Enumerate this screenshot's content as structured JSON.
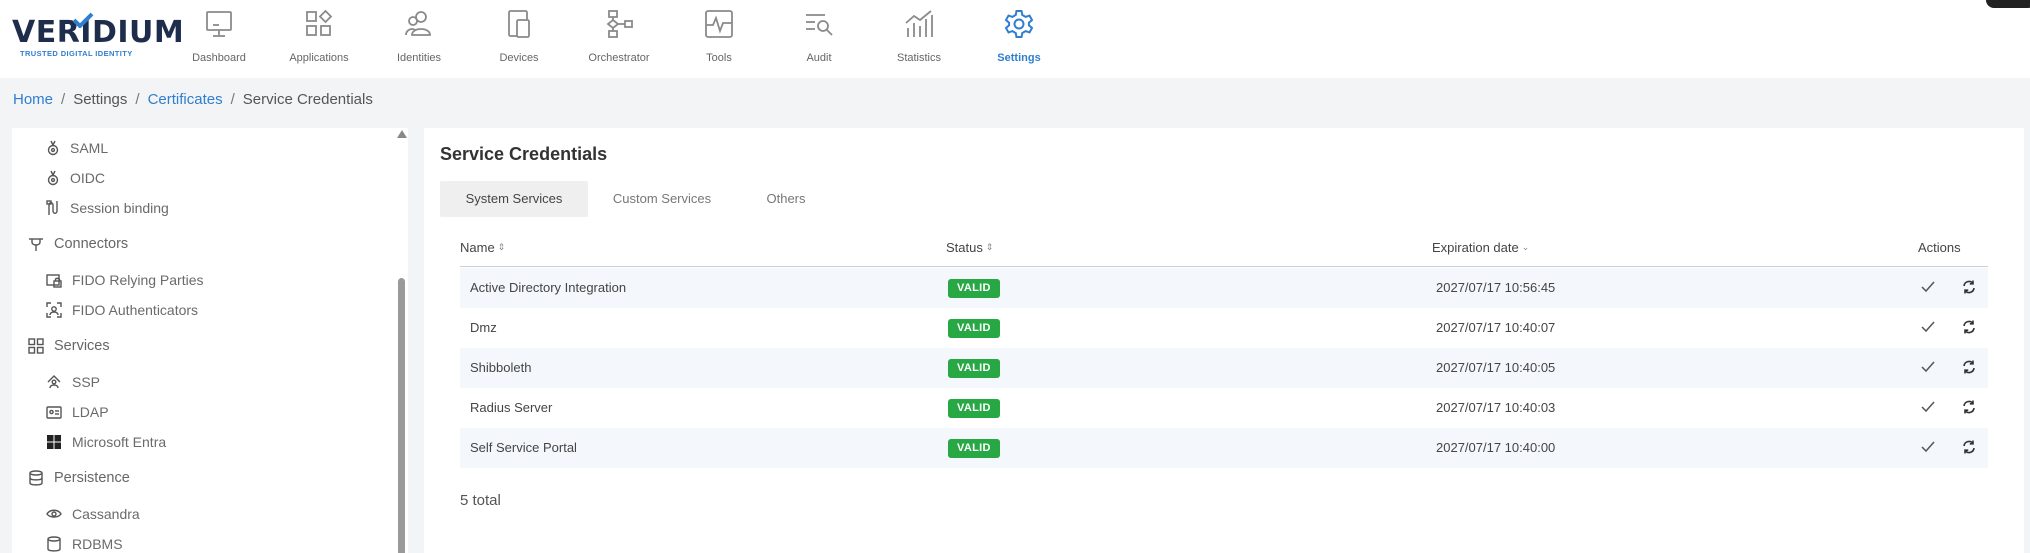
{
  "app": {
    "logo_text": "VERIDIUM",
    "logo_tagline": "TRUSTED DIGITAL IDENTITY"
  },
  "nav": {
    "items": [
      {
        "label": "Dashboard",
        "icon": "monitor-icon",
        "active": false
      },
      {
        "label": "Applications",
        "icon": "applications-grid-icon",
        "active": false
      },
      {
        "label": "Identities",
        "icon": "identities-users-icon",
        "active": false
      },
      {
        "label": "Devices",
        "icon": "devices-icon",
        "active": false
      },
      {
        "label": "Orchestrator",
        "icon": "orchestrator-flow-icon",
        "active": false
      },
      {
        "label": "Tools",
        "icon": "tools-pulse-icon",
        "active": false
      },
      {
        "label": "Audit",
        "icon": "audit-search-icon",
        "active": false
      },
      {
        "label": "Statistics",
        "icon": "statistics-chart-icon",
        "active": false
      },
      {
        "label": "Settings",
        "icon": "gear-icon",
        "active": true
      }
    ]
  },
  "breadcrumb": {
    "home": "Home",
    "settings": "Settings",
    "certificates": "Certificates",
    "current": "Service Credentials",
    "separator": "/"
  },
  "sidebar": {
    "items": [
      {
        "label": "SAML",
        "icon": "saml-icon",
        "type": "sub"
      },
      {
        "label": "OIDC",
        "icon": "oidc-icon",
        "type": "sub"
      },
      {
        "label": "Session binding",
        "icon": "session-binding-icon",
        "type": "sub"
      },
      {
        "label": "Connectors",
        "icon": "plug-icon",
        "type": "group"
      },
      {
        "label": "FIDO Relying Parties",
        "icon": "fido-lock-icon",
        "type": "sub"
      },
      {
        "label": "FIDO Authenticators",
        "icon": "fido-scan-icon",
        "type": "sub"
      },
      {
        "label": "Services",
        "icon": "services-grid-icon",
        "type": "group"
      },
      {
        "label": "SSP",
        "icon": "ssp-icon",
        "type": "sub"
      },
      {
        "label": "LDAP",
        "icon": "ldap-icon",
        "type": "sub"
      },
      {
        "label": "Microsoft Entra",
        "icon": "windows-icon",
        "type": "sub"
      },
      {
        "label": "Persistence",
        "icon": "database-icon",
        "type": "group"
      },
      {
        "label": "Cassandra",
        "icon": "eye-icon",
        "type": "sub"
      },
      {
        "label": "RDBMS",
        "icon": "rdbms-icon",
        "type": "sub"
      }
    ]
  },
  "main": {
    "title": "Service Credentials",
    "tabs": [
      {
        "label": "System Services",
        "active": true
      },
      {
        "label": "Custom Services",
        "active": false
      },
      {
        "label": "Others",
        "active": false
      }
    ],
    "columns": {
      "name": "Name",
      "status": "Status",
      "expiration": "Expiration date",
      "actions": "Actions"
    },
    "rows": [
      {
        "name": "Active Directory Integration",
        "status": "VALID",
        "expiration": "2027/07/17 10:56:45"
      },
      {
        "name": "Dmz",
        "status": "VALID",
        "expiration": "2027/07/17 10:40:07"
      },
      {
        "name": "Shibboleth",
        "status": "VALID",
        "expiration": "2027/07/17 10:40:05"
      },
      {
        "name": "Radius Server",
        "status": "VALID",
        "expiration": "2027/07/17 10:40:03"
      },
      {
        "name": "Self Service Portal",
        "status": "VALID",
        "expiration": "2027/07/17 10:40:00"
      }
    ],
    "total": "5 total"
  },
  "colors": {
    "accent": "#2f7ecf",
    "valid": "#28a745",
    "nav_icon": "#8a8a8a"
  }
}
